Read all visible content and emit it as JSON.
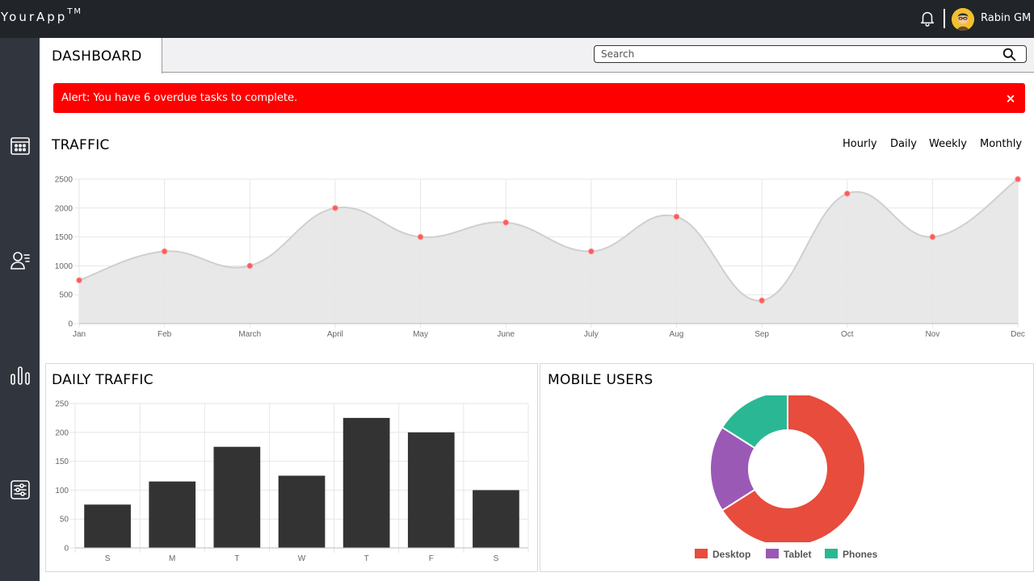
{
  "app": {
    "brand": "YourApp",
    "brand_mark": "TM"
  },
  "user": {
    "name": "Rabin GM"
  },
  "header": {
    "title": "DASHBOARD"
  },
  "search": {
    "placeholder": "Search"
  },
  "alert": {
    "text": "Alert: You have 6 overdue tasks to complete.",
    "close_label": "×",
    "color": "#ff0000"
  },
  "traffic": {
    "title": "TRAFFIC",
    "ranges": [
      "Hourly",
      "Daily",
      "Weekly",
      "Monthly"
    ]
  },
  "daily_traffic": {
    "title": "DAILY TRAFFIC"
  },
  "mobile_users": {
    "title": "MOBILE USERS"
  },
  "sidebar": {
    "items": [
      {
        "icon": "calendar-icon"
      },
      {
        "icon": "users-list-icon"
      },
      {
        "icon": "bar-chart-icon"
      },
      {
        "icon": "sliders-icon"
      }
    ]
  },
  "chart_data": [
    {
      "type": "area",
      "title": "",
      "x": [
        "Jan",
        "Feb",
        "March",
        "April",
        "May",
        "June",
        "July",
        "Aug",
        "Sep",
        "Oct",
        "Nov",
        "Dec"
      ],
      "values": [
        750,
        1250,
        1000,
        2000,
        1500,
        1750,
        1250,
        1850,
        400,
        2250,
        1500,
        2500
      ],
      "ylim": [
        0,
        2500
      ],
      "yticks": [
        0,
        500,
        1000,
        1500,
        2000,
        2500
      ],
      "grid": true,
      "line_color": "#cfcfcf",
      "fill_color": "#e6e6e6",
      "point_color": "#ff5a5a"
    },
    {
      "type": "bar",
      "categories": [
        "S",
        "M",
        "T",
        "W",
        "T",
        "F",
        "S"
      ],
      "values": [
        75,
        115,
        175,
        125,
        225,
        200,
        100
      ],
      "ylim": [
        0,
        250
      ],
      "yticks": [
        0,
        50,
        100,
        150,
        200,
        250
      ],
      "grid": true,
      "bar_color": "#333333"
    },
    {
      "type": "pie",
      "donut": true,
      "labels": [
        "Desktop",
        "Tablet",
        "Phones"
      ],
      "values": [
        66,
        18,
        16
      ],
      "colors": [
        "#e74c3c",
        "#9b59b6",
        "#2ab894"
      ],
      "legend": "bottom"
    }
  ]
}
